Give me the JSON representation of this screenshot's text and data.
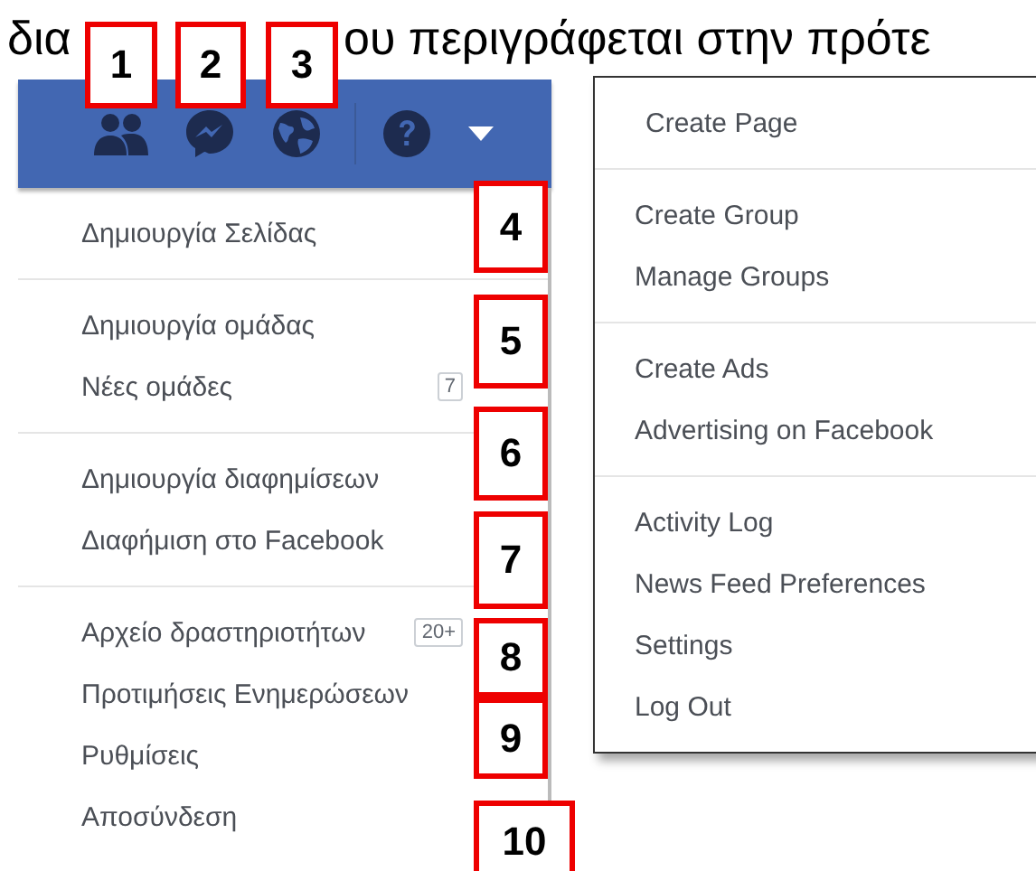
{
  "document_text": [
    "δια",
    "ου περιγράφεται στην πρότε"
  ],
  "greek_menu": {
    "sections": [
      {
        "items": [
          {
            "label": "Δημιουργία Σελίδας"
          }
        ]
      },
      {
        "items": [
          {
            "label": "Δημιουργία ομάδας"
          },
          {
            "label": "Νέες ομάδες",
            "badge": "7"
          }
        ]
      },
      {
        "items": [
          {
            "label": "Δημιουργία διαφημίσεων"
          },
          {
            "label": "Διαφήμιση στο Facebook"
          }
        ]
      },
      {
        "items": [
          {
            "label": "Αρχείο δραστηριοτήτων",
            "badge": "20+"
          },
          {
            "label": "Προτιμήσεις Ενημερώσεων"
          },
          {
            "label": "Ρυθμίσεις"
          },
          {
            "label": "Αποσύνδεση"
          }
        ]
      }
    ]
  },
  "english_menu": {
    "sections": [
      {
        "items": [
          {
            "label": "Create Page"
          }
        ]
      },
      {
        "items": [
          {
            "label": "Create Group"
          },
          {
            "label": "Manage Groups"
          }
        ]
      },
      {
        "items": [
          {
            "label": "Create Ads"
          },
          {
            "label": "Advertising on Facebook"
          }
        ]
      },
      {
        "items": [
          {
            "label": "Activity Log"
          },
          {
            "label": "News Feed Preferences"
          },
          {
            "label": "Settings"
          },
          {
            "label": "Log Out"
          }
        ]
      }
    ]
  },
  "callouts": [
    "1",
    "2",
    "3",
    "4",
    "5",
    "6",
    "7",
    "8",
    "9",
    "10"
  ]
}
